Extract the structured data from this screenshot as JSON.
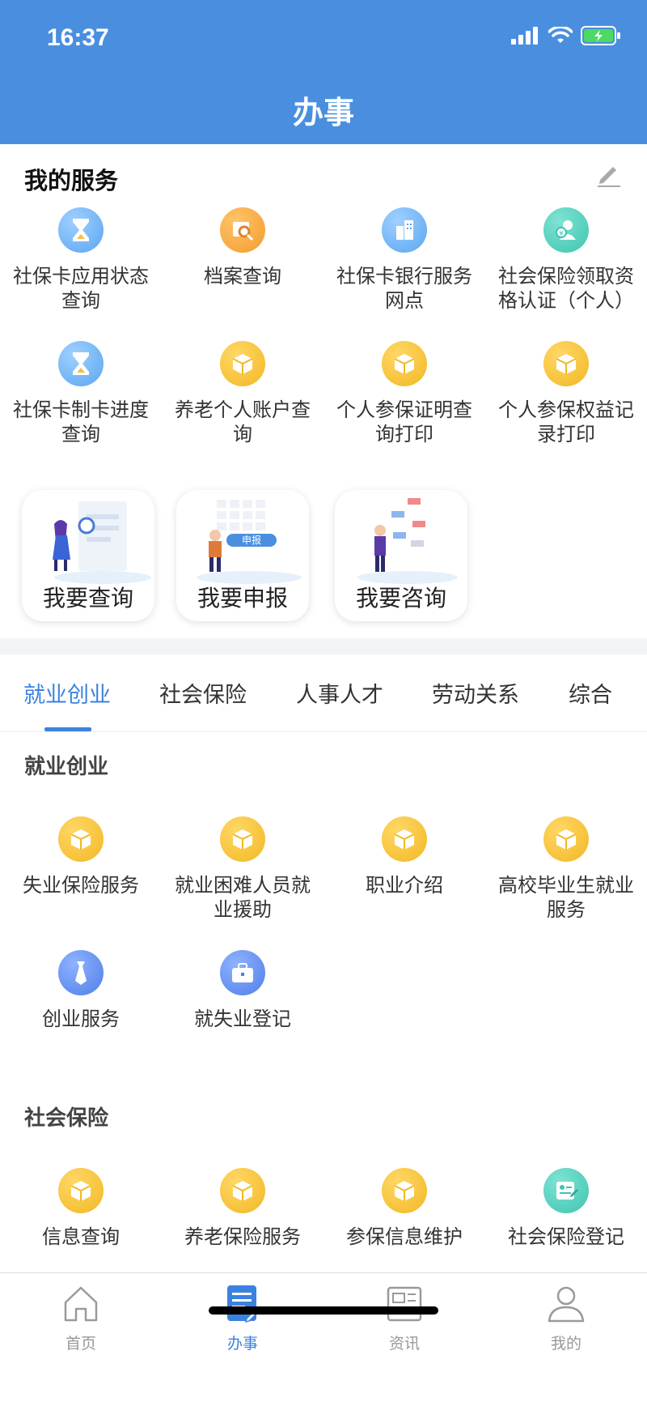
{
  "status_bar": {
    "time": "16:37"
  },
  "header": {
    "title": "办事"
  },
  "my_services": {
    "title": "我的服务",
    "items": [
      {
        "label": "社保卡应用状态查询",
        "icon": "hourglass-icon",
        "color": "blue"
      },
      {
        "label": "档案查询",
        "icon": "file-search-icon",
        "color": "orange"
      },
      {
        "label": "社保卡银行服务网点",
        "icon": "building-icon",
        "color": "blue"
      },
      {
        "label": "社会保险领取资格认证（个人）",
        "icon": "person-verify-icon",
        "color": "teal"
      },
      {
        "label": "社保卡制卡进度查询",
        "icon": "hourglass-icon",
        "color": "blue"
      },
      {
        "label": "养老个人账户查询",
        "icon": "box-icon",
        "color": "yellow"
      },
      {
        "label": "个人参保证明查询打印",
        "icon": "box-icon",
        "color": "yellow"
      },
      {
        "label": "个人参保权益记录打印",
        "icon": "box-icon",
        "color": "yellow"
      }
    ],
    "cards": [
      {
        "label": "我要查询",
        "illustration": "query-illustration"
      },
      {
        "label": "我要申报",
        "illustration": "declare-illustration",
        "tag": "申报"
      },
      {
        "label": "我要咨询",
        "illustration": "consult-illustration"
      }
    ]
  },
  "tabs": [
    "就业创业",
    "社会保险",
    "人事人才",
    "劳动关系",
    "综合"
  ],
  "active_tab": "就业创业",
  "categories": [
    {
      "title": "就业创业",
      "items": [
        {
          "label": "失业保险服务",
          "icon": "box-icon",
          "color": "yellow"
        },
        {
          "label": "就业困难人员就业援助",
          "icon": "box-icon",
          "color": "yellow"
        },
        {
          "label": "职业介绍",
          "icon": "box-icon",
          "color": "yellow"
        },
        {
          "label": "高校毕业生就业服务",
          "icon": "box-icon",
          "color": "yellow"
        },
        {
          "label": "创业服务",
          "icon": "tie-icon",
          "color": "indigo"
        },
        {
          "label": "就失业登记",
          "icon": "briefcase-icon",
          "color": "indigo"
        }
      ]
    },
    {
      "title": "社会保险",
      "items": [
        {
          "label": "信息查询",
          "icon": "box-icon",
          "color": "yellow"
        },
        {
          "label": "养老保险服务",
          "icon": "box-icon",
          "color": "yellow"
        },
        {
          "label": "参保信息维护",
          "icon": "box-icon",
          "color": "yellow"
        },
        {
          "label": "社会保险登记",
          "icon": "register-icon",
          "color": "teal"
        }
      ]
    }
  ],
  "bottom_nav": [
    {
      "label": "首页",
      "icon": "home-icon"
    },
    {
      "label": "办事",
      "icon": "document-pen-icon"
    },
    {
      "label": "资讯",
      "icon": "news-icon"
    },
    {
      "label": "我的",
      "icon": "user-icon"
    }
  ],
  "active_nav": "办事",
  "colors": {
    "header": "#4a8fdf",
    "accent": "#3b82e0"
  }
}
